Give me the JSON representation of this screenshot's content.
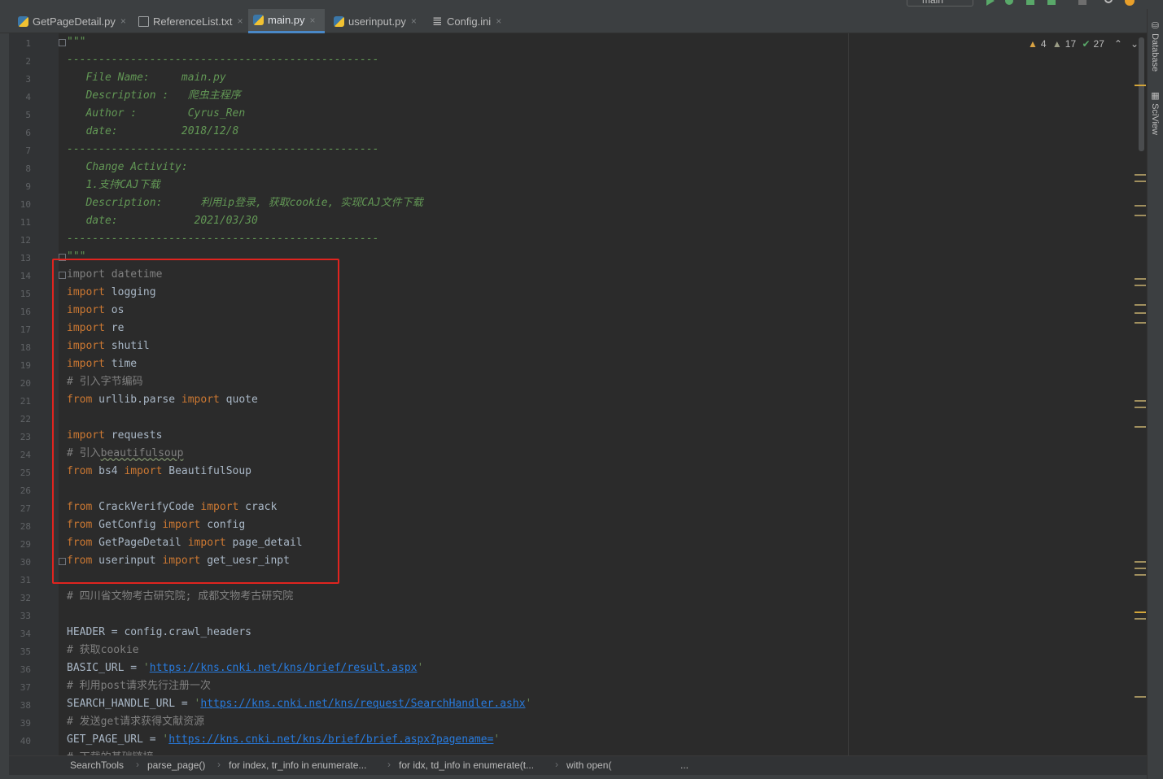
{
  "topbar": {
    "branch_label": "main"
  },
  "tabs": [
    {
      "label": "GetPageDetail.py",
      "icon": "python-file-icon",
      "active": false
    },
    {
      "label": "ReferenceList.txt",
      "icon": "text-file-icon",
      "active": false
    },
    {
      "label": "main.py",
      "icon": "python-file-icon",
      "active": true
    },
    {
      "label": "userinput.py",
      "icon": "python-file-icon",
      "active": false
    },
    {
      "label": "Config.ini",
      "icon": "ini-file-icon",
      "active": false
    }
  ],
  "tab_close_glyph": "×",
  "line_numbers": [
    "1",
    "2",
    "3",
    "4",
    "5",
    "6",
    "7",
    "8",
    "9",
    "10",
    "11",
    "12",
    "13",
    "14",
    "15",
    "16",
    "17",
    "18",
    "19",
    "20",
    "21",
    "22",
    "23",
    "24",
    "25",
    "26",
    "27",
    "28",
    "29",
    "30",
    "31",
    "32",
    "33",
    "34",
    "35",
    "36",
    "37",
    "38",
    "39",
    "40"
  ],
  "code": {
    "l1": "\"\"\"",
    "l2": "-------------------------------------------------",
    "l3": "   File Name:     main.py",
    "l4": "   Description :   爬虫主程序",
    "l5": "   Author :        Cyrus_Ren",
    "l6": "   date:          2018/12/8",
    "l7": "-------------------------------------------------",
    "l8": "   Change Activity:",
    "l9": "   1.支持CAJ下载",
    "l10": "   Description:      利用ip登录, 获取cookie, 实现CAJ文件下载",
    "l11": "   date:            2021/03/30",
    "l12": "-------------------------------------------------",
    "l13": "\"\"\"",
    "l14_kw": "import",
    "l14_rest": " datetime",
    "l15_kw": "import",
    "l15_rest": " logging",
    "l16_kw": "import",
    "l16_rest": " os",
    "l17_kw": "import",
    "l17_rest": " re",
    "l18_kw": "import",
    "l18_rest": " shutil",
    "l19_kw": "import",
    "l19_rest": " time",
    "l20": "# 引入字节编码",
    "l21_a": "from",
    "l21_b": " urllib.parse ",
    "l21_c": "import",
    "l21_d": " quote",
    "l23_kw": "import",
    "l23_rest": " requests",
    "l24_a": "# 引入",
    "l24_b": "beautifulsoup",
    "l25_a": "from",
    "l25_b": " bs4 ",
    "l25_c": "import",
    "l25_d": " BeautifulSoup",
    "l27_a": "from",
    "l27_b": " CrackVerifyCode ",
    "l27_c": "import",
    "l27_d": " crack",
    "l28_a": "from",
    "l28_b": " GetConfig ",
    "l28_c": "import",
    "l28_d": " config",
    "l29_a": "from",
    "l29_b": " GetPageDetail ",
    "l29_c": "import",
    "l29_d": " page_detail",
    "l30_a": "from",
    "l30_b": " userinput ",
    "l30_c": "import",
    "l30_d": " get_uesr_inpt",
    "l32": "# 四川省文物考古研究院; 成都文物考古研究院",
    "l34": "HEADER = config.crawl_headers",
    "l35": "# 获取cookie",
    "l36_a": "BASIC_URL = ",
    "l36_q": "'",
    "l36_url": "https://kns.cnki.net/kns/brief/result.aspx",
    "l36_q2": "'",
    "l37": "# 利用post请求先行注册一次",
    "l38_a": "SEARCH_HANDLE_URL = ",
    "l38_q": "'",
    "l38_url": "https://kns.cnki.net/kns/request/SearchHandler.ashx",
    "l38_q2": "'",
    "l39": "# 发送get请求获得文献资源",
    "l40_a": "GET_PAGE_URL = ",
    "l40_q": "'",
    "l40_url": "https://kns.cnki.net/kns/brief/brief.aspx?pagename=",
    "l40_q2": "'",
    "l41_partial": "# 下载的基础链接"
  },
  "inspections": {
    "warnings": "4",
    "weak_warnings": "17",
    "typos": "27"
  },
  "sidebar_tabs": [
    "Database",
    "SciView"
  ],
  "breadcrumb": [
    "SearchTools",
    "parse_page()",
    "for index, tr_info in enumerate...",
    "for idx, td_info in enumerate(t...",
    "with open(",
    "..."
  ],
  "colors": {
    "keyword": "#cc7832",
    "docstring": "#629755",
    "comment": "#808080",
    "string": "#6a8759",
    "url": "#287bde",
    "highlight_box": "#e0241f"
  }
}
